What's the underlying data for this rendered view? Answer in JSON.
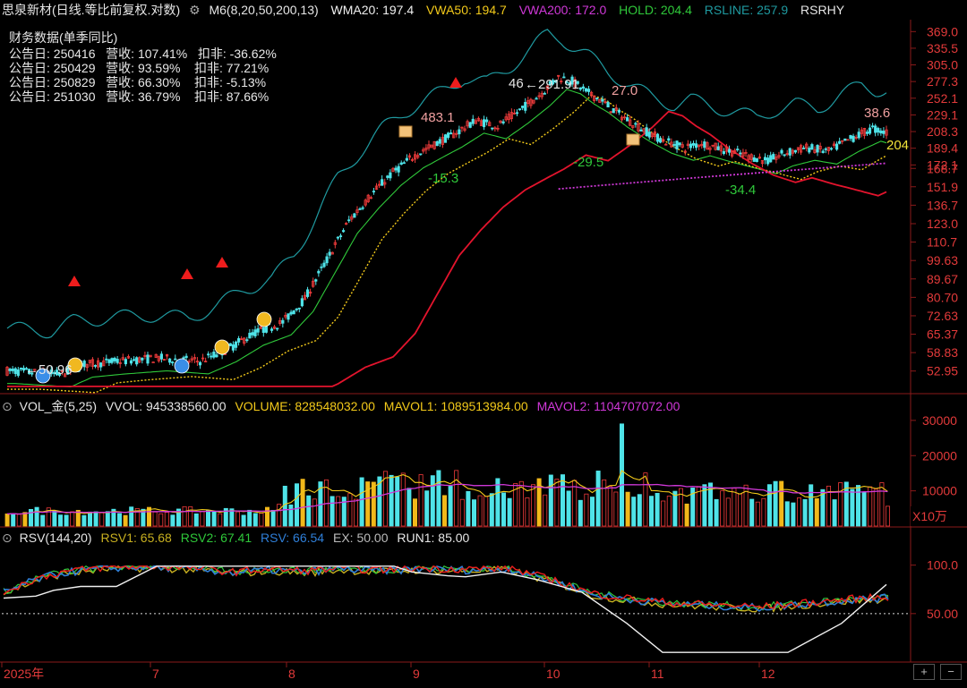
{
  "header": {
    "stock_name": "思泉新材(日线.等比前复权.对数)",
    "indicator": "M6(8,20,50,200,13)",
    "wma20": "WMA20: 197.4",
    "vwa50": "VWA50: 194.7",
    "vwa200": "VWA200: 172.0",
    "hold": "HOLD: 204.4",
    "rsline": "RSLINE: 257.9",
    "rsrhy": "RSRHY"
  },
  "finance": {
    "title": "财务数据(单季同比)",
    "rows": [
      "公告日: 250416   营收: 107.41%   扣非: -36.62%",
      "公告日: 250429   营收: 93.59%    扣非: 77.21%",
      "公告日: 250829   营收: 66.30%    扣非: -5.13%",
      "公告日: 251030   营收: 36.79%    扣非: 87.66%"
    ]
  },
  "vol_header": {
    "name": "VOL_金(5,25)",
    "vvol": "VVOL: 945338560.00",
    "volume": "VOLUME: 828548032.00",
    "mavol1": "MAVOL1: 1089513984.00",
    "mavol2": "MAVOL2: 1104707072.00"
  },
  "rsv_header": {
    "name": "RSV(144,20)",
    "rsv1": "RSV1: 65.68",
    "rsv2": "RSV2: 67.41",
    "rsv": "RSV: 66.54",
    "ex": "EX: 50.00",
    "run1": "RUN1: 85.00"
  },
  "colors": {
    "up": "#ef3b3b",
    "down": "#4fe3e8",
    "wma20": "#f2e33a",
    "vwa50": "#f2c91a",
    "vwa200": "#e0147a",
    "hold": "#2fc83a",
    "rsline": "#1f9aa0",
    "purple": "#d038d8"
  },
  "chart_data": [
    {
      "type": "candlestick",
      "title": "思泉新材(日线.等比前复权.对数)",
      "y_scale": "log",
      "ylim": [
        47,
        395
      ],
      "y_ticks": [
        "369.0",
        "335.5",
        "305.0",
        "277.3",
        "252.1",
        "229.1",
        "208.3",
        "189.4",
        "172.1",
        "168.7",
        "151.9",
        "136.7",
        "123.0",
        "110.7",
        "99.63",
        "89.67",
        "80.70",
        "72.63",
        "65.37",
        "58.83",
        "52.95"
      ],
      "x_months": [
        "2025年",
        "7",
        "8",
        "9",
        "10",
        "11",
        "12"
      ],
      "series": [
        {
          "name": "WMA20",
          "last": 197.4
        },
        {
          "name": "VWA50",
          "last": 194.7
        },
        {
          "name": "VWA200",
          "last": 172.0
        },
        {
          "name": "HOLD",
          "last": 204.4
        },
        {
          "name": "RSLINE",
          "last": 257.9
        }
      ],
      "annotations": [
        "50.96",
        "483.1",
        "-15.3",
        "291.91",
        "27.0",
        "-29.5",
        "-34.4",
        "38.6",
        "204",
        "46"
      ]
    },
    {
      "type": "bar",
      "title": "VOL_金(5,25)",
      "unit": "X10万",
      "y_ticks": [
        "30000",
        "20000",
        "10000"
      ],
      "ylim": [
        0,
        32000
      ],
      "series": [
        {
          "name": "VVOL",
          "last": 945338560.0
        },
        {
          "name": "VOLUME",
          "last": 828548032.0
        },
        {
          "name": "MAVOL1",
          "last": 1089513984.0
        },
        {
          "name": "MAVOL2",
          "last": 1104707072.0
        }
      ]
    },
    {
      "type": "line",
      "title": "RSV(144,20)",
      "y_ticks": [
        "100.0",
        "50.00"
      ],
      "ylim": [
        0,
        120
      ],
      "series": [
        {
          "name": "RSV1",
          "last": 65.68
        },
        {
          "name": "RSV2",
          "last": 67.41
        },
        {
          "name": "RSV",
          "last": 66.54
        },
        {
          "name": "EX",
          "last": 50.0
        },
        {
          "name": "RUN1",
          "last": 85.0
        }
      ]
    }
  ],
  "vol_unit": "X10万",
  "buttons": {
    "plus": "+",
    "minus": "−"
  }
}
